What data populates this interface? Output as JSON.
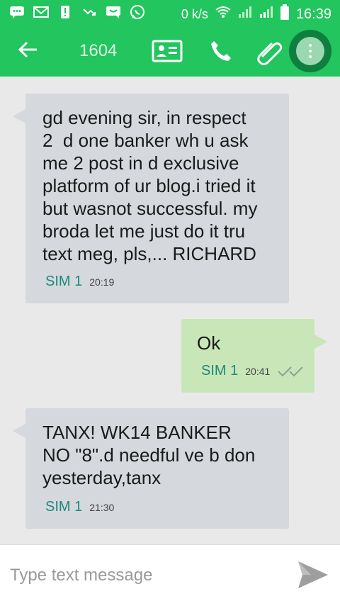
{
  "status_bar": {
    "net_speed": "0 k/s",
    "time": "16:39",
    "notification_icons": [
      "chat-icon",
      "gmail-icon",
      "alert-icon",
      "missed-call-icon",
      "message-icon",
      "whatsapp-icon"
    ],
    "system_icons": [
      "wifi-icon",
      "signal-icon",
      "signal-icon",
      "battery-icon"
    ]
  },
  "toolbar": {
    "title": "1604",
    "back_icon": "back-arrow-icon",
    "contact_icon": "contact-card-icon",
    "call_icon": "phone-icon",
    "attach_icon": "attach-icon",
    "more_icon": "more-vert-icon",
    "accent_color": "#22c55e"
  },
  "messages": [
    {
      "direction": "incoming",
      "text": "gd evening sir, in respect\n2  d one banker wh u ask\nme 2 post in d exclusive\nplatform of ur blog.i tried it\nbut wasnot successful. my\nbroda let me just do it tru\ntext meg, pls,... RICHARD",
      "sim": "SIM 1",
      "time": "20:19"
    },
    {
      "direction": "outgoing",
      "text": "Ok",
      "sim": "SIM 1",
      "time": "20:41",
      "status_icon": "double-check-icon"
    },
    {
      "direction": "incoming",
      "text": "TANX! WK14 BANKER\nNO \"8\".d needful ve b don\nyesterday,tanx",
      "sim": "SIM 1",
      "time": "21:30"
    }
  ],
  "composer": {
    "placeholder": "Type text message",
    "value": "",
    "send_icon": "send-icon"
  }
}
